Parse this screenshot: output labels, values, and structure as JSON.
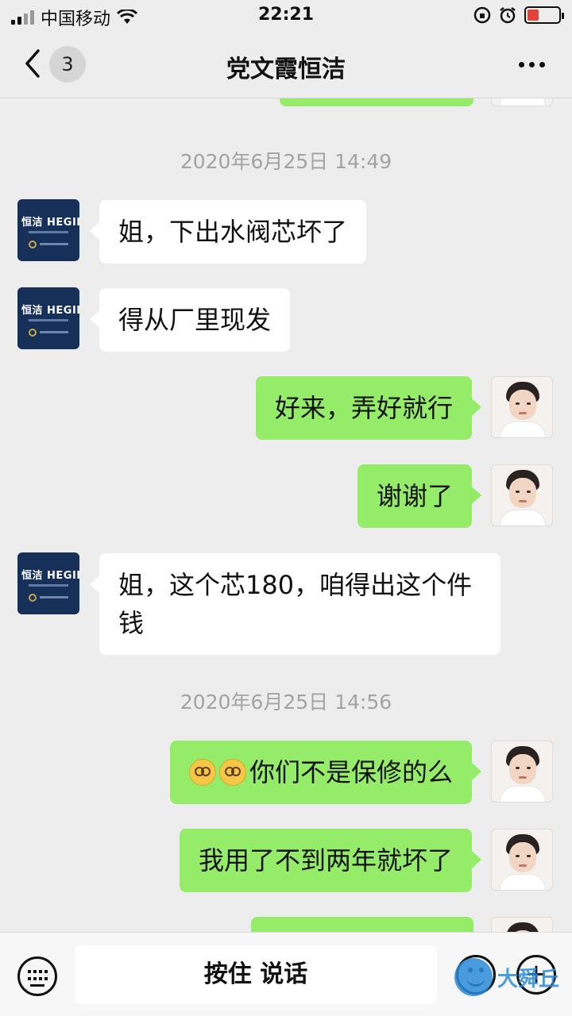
{
  "status_bar": {
    "carrier": "中国移动",
    "time": "22:21"
  },
  "nav": {
    "back_badge": "3",
    "title": "党文霞恒洁"
  },
  "avatars": {
    "brand_logo": "恒洁 HEGII"
  },
  "messages": [
    {
      "kind": "time",
      "text": "2020年6月25日 14:49"
    },
    {
      "kind": "in",
      "text": "姐，下出水阀芯坏了"
    },
    {
      "kind": "in",
      "text": "得从厂里现发"
    },
    {
      "kind": "out",
      "text": "好来，弄好就行"
    },
    {
      "kind": "out",
      "text": "谢谢了"
    },
    {
      "kind": "in",
      "text": "姐，这个芯180，咱得出这个件钱"
    },
    {
      "kind": "time",
      "text": "2020年6月25日 14:56"
    },
    {
      "kind": "out",
      "text": "你们不是保修的么"
    },
    {
      "kind": "out",
      "text": "我用了不到两年就坏了"
    }
  ],
  "input_bar": {
    "hold_to_talk": "按住 说话"
  },
  "watermark": {
    "text": "大舜丘"
  },
  "colors": {
    "background": "#ededed",
    "outgoing_bubble": "#95ec69",
    "incoming_bubble": "#ffffff"
  }
}
